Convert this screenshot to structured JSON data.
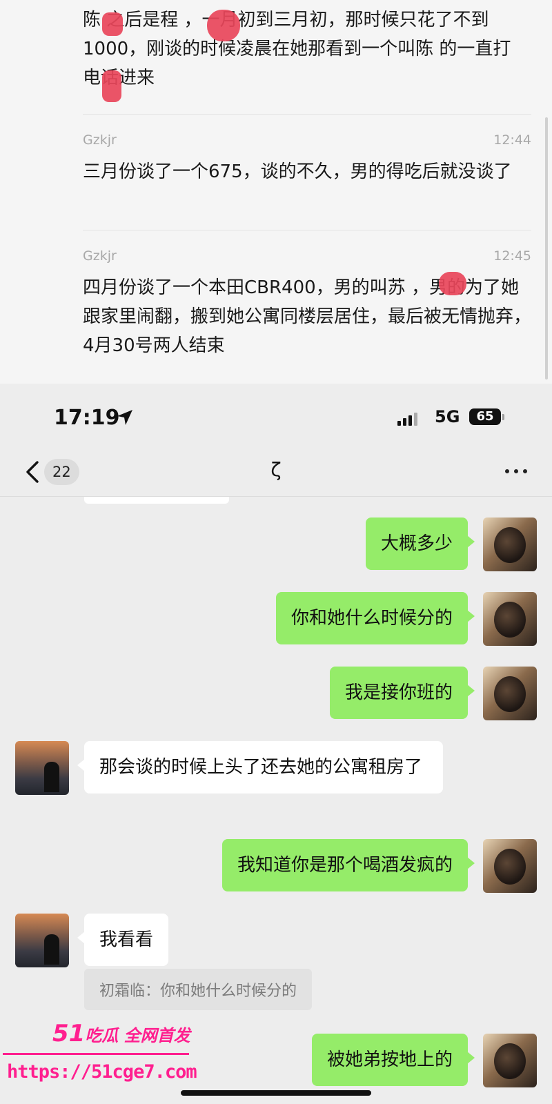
{
  "records": {
    "top_text": "陈 之后是程 ，一月初到三月初，那时候只花了不到1000，刚谈的时候凌晨在她那看到一个叫陈 的一直打电话进来",
    "items": [
      {
        "sender": "Gzkjr",
        "time": "12:44",
        "text": "三月份谈了一个675，谈的不久，男的得吃后就没谈了"
      },
      {
        "sender": "Gzkjr",
        "time": "12:45",
        "text": "四月份谈了一个本田CBR400，男的叫苏 ，男的为了她跟家里闹翻，搬到她公寓同楼层居住，最后被无情抛弃，4月30号两人结束"
      }
    ]
  },
  "status_bar": {
    "time": "17:19",
    "network": "5G",
    "battery": "65"
  },
  "nav": {
    "back_count": "22",
    "title": "ζ"
  },
  "messages": [
    {
      "from": "me",
      "text": "大概多少"
    },
    {
      "from": "me",
      "text": "你和她什么时候分的"
    },
    {
      "from": "me",
      "text": "我是接你班的"
    },
    {
      "from": "other",
      "text": "那会谈的时候上头了还去她的公寓租房了"
    },
    {
      "from": "me",
      "text": "我知道你是那个喝酒发疯的"
    },
    {
      "from": "other",
      "text": "我看看"
    },
    {
      "from": "me",
      "text": "被她弟按地上的"
    }
  ],
  "quote": "初霜临：你和她什么时候分的",
  "watermark": {
    "brand_num": "51",
    "brand_text": "吃瓜 全网首发",
    "url": "https://51cge7.com"
  },
  "colors": {
    "my_bubble": "#95ec69",
    "other_bubble": "#ffffff",
    "chat_bg": "#ededed",
    "watermark": "#ff1f8f",
    "redaction": "#e8455a"
  },
  "icons": [
    "location-arrow-icon",
    "signal-icon",
    "back-chevron-icon",
    "more-icon"
  ]
}
